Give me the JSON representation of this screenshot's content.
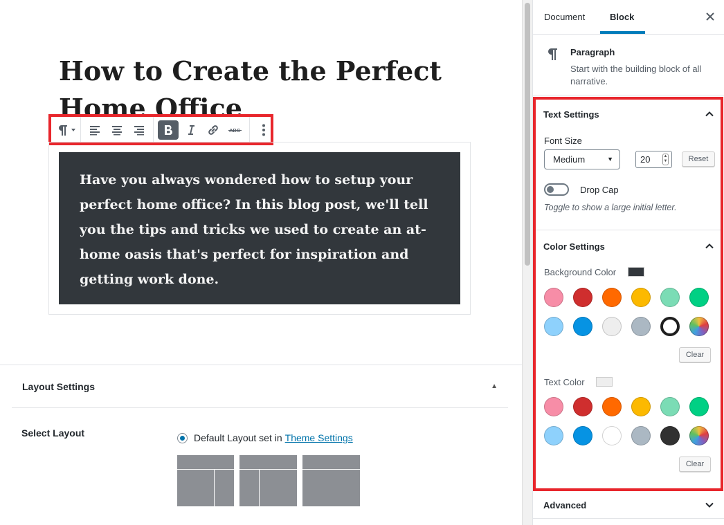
{
  "editor": {
    "post_title": "How to Create the Perfect Home Office",
    "paragraph": "Have you always wondered how to setup your perfect home office? In this blog post, we'll tell you the tips and tricks we used to create an at-home oasis that's perfect for inspiration and getting work done.",
    "paragraph_bg_color": "#32373c",
    "paragraph_text_color": "#f3f3f3"
  },
  "toolbar": {
    "items": [
      {
        "name": "paragraph-transform",
        "icon": "paragraph-icon"
      },
      {
        "name": "align-left",
        "icon": "align-left-icon"
      },
      {
        "name": "align-center",
        "icon": "align-center-icon"
      },
      {
        "name": "align-right",
        "icon": "align-right-icon"
      },
      {
        "name": "bold",
        "icon": "bold-icon",
        "active": true
      },
      {
        "name": "italic",
        "icon": "italic-icon"
      },
      {
        "name": "link",
        "icon": "link-icon"
      },
      {
        "name": "strikethrough",
        "icon": "strikethrough-icon",
        "label": "ABC"
      },
      {
        "name": "more-options",
        "icon": "more-vertical-icon"
      }
    ]
  },
  "layout_panel": {
    "title": "Layout Settings",
    "select_layout_label": "Select Layout",
    "default_layout_text": "Default Layout set in",
    "theme_settings_link": "Theme Settings"
  },
  "sidebar": {
    "tabs": [
      "Document",
      "Block"
    ],
    "active_tab": "Block",
    "block": {
      "name": "Paragraph",
      "description": "Start with the building block of all narrative."
    },
    "text_settings": {
      "title": "Text Settings",
      "font_size_label": "Font Size",
      "font_size_select": "Medium",
      "font_size_value": "20",
      "reset_label": "Reset",
      "drop_cap_label": "Drop Cap",
      "drop_cap_help": "Toggle to show a large initial letter.",
      "drop_cap_enabled": false
    },
    "color_settings": {
      "title": "Color Settings",
      "background_label": "Background Color",
      "background_current": "#32373c",
      "background_palette": [
        "#f78da7",
        "#cf2e2e",
        "#ff6900",
        "#fcb900",
        "#7bdcb5",
        "#00d084",
        "#8ed1fc",
        "#0693e3",
        "#eeeeee",
        "#abb8c3",
        "#ffffff",
        "gradient"
      ],
      "background_selected_index": 10,
      "text_label": "Text Color",
      "text_current": "#eeeeee",
      "text_palette": [
        "#f78da7",
        "#cf2e2e",
        "#ff6900",
        "#fcb900",
        "#7bdcb5",
        "#00d084",
        "#8ed1fc",
        "#0693e3",
        "#ffffff",
        "#abb8c3",
        "#313131",
        "gradient"
      ],
      "clear_label": "Clear"
    },
    "advanced_title": "Advanced"
  },
  "colors": {
    "highlight": "#e8262c",
    "accent": "#007cba",
    "link": "#0073aa"
  }
}
